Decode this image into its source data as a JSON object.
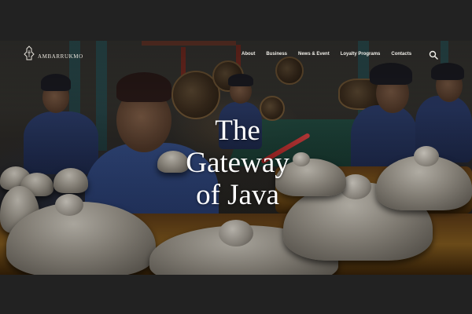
{
  "brand": {
    "name": "AMBARRUKMO"
  },
  "nav": {
    "items": [
      {
        "label": "About"
      },
      {
        "label": "Business"
      },
      {
        "label": "News & Event"
      },
      {
        "label": "Loyalty Programs"
      },
      {
        "label": "Contacts"
      }
    ],
    "search_icon": "search-icon"
  },
  "hero": {
    "headline_lines": [
      "The",
      "Gateway",
      "of Java"
    ],
    "image_description": "gamelan-musicians-photo"
  },
  "colors": {
    "letterbox": "#222222",
    "headline_text": "#ffffff",
    "nav_text": "#f1efe9"
  }
}
